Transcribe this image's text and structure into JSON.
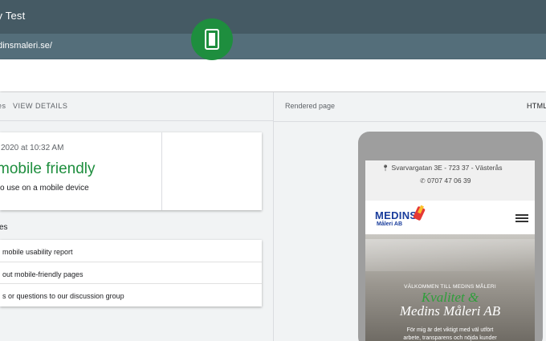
{
  "header": {
    "title": "dly Test"
  },
  "urlbar": {
    "url": "edinsmaleri.se/"
  },
  "left_panel": {
    "tab_a": "es",
    "tab_b": "VIEW DETAILS",
    "result": {
      "date": "2020 at 10:32 AM",
      "headline": "mobile friendly",
      "subtitle": "o use on a mobile device"
    },
    "resources_title": "ces",
    "resources": [
      "mobile usability report",
      "out mobile-friendly pages",
      "s or questions to our discussion group"
    ]
  },
  "right_panel": {
    "title": "Rendered page",
    "html_tab": "HTML"
  },
  "rendered": {
    "address": "Svarvargatan 3E - 723 37 - Västerås",
    "phone": "0707 47 06 39",
    "logo_line1": "MEDINS",
    "logo_line2": "Måleri AB",
    "hero_welcome": "VÄLKOMMEN TILL MEDINS MÅLERI",
    "hero_title1": "Kvalitet &",
    "hero_title2": "Medins Måleri AB",
    "hero_para_line1": "För mig är det viktigt med väl utfört",
    "hero_para_line2": "arbete, transparens och nöjda kunder"
  },
  "colors": {
    "topbar": "#455a64",
    "urlbar": "#546e7a",
    "success_green": "#1e8e3e",
    "logo_blue": "#1a3d9c"
  },
  "icons": {
    "result_icon": "smartphone-icon",
    "address_icon": "map-pin-icon",
    "phone_icon": "phone-icon",
    "menu_icon": "hamburger-menu-icon"
  }
}
